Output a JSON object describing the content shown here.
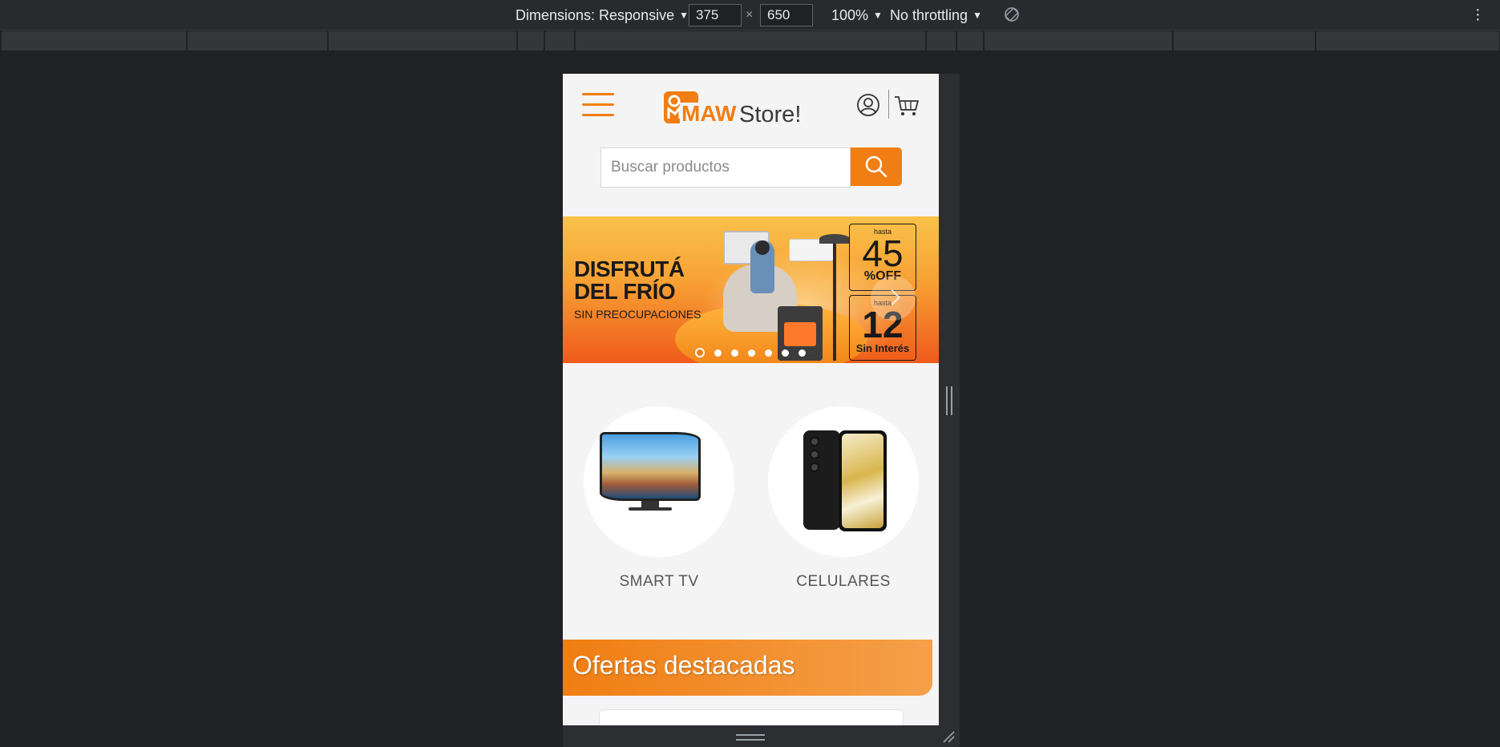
{
  "devtools": {
    "dimensions_label": "Dimensions: Responsive",
    "width_value": "375",
    "times": "×",
    "height_value": "650",
    "zoom": "100%",
    "throttling": "No throttling"
  },
  "site": {
    "logo_primary": "MAW",
    "logo_secondary": "Store!",
    "search_placeholder": "Buscar productos",
    "banner": {
      "headline_1": "DISFRUTÁ",
      "headline_2": "DEL FRÍO",
      "subline": "SIN PREOCUPACIONES",
      "promo1_small": "hasta",
      "promo1_big": "45",
      "promo1_tag": "%OFF",
      "promo2_small": "hasta",
      "promo2_big": "12",
      "promo2_tag": "Sin Interés",
      "slides": 7,
      "active_slide": 1
    },
    "categories": [
      {
        "label": "SMART TV",
        "icon": "smart-tv-image"
      },
      {
        "label": "CELULARES",
        "icon": "smartphone-image"
      }
    ],
    "section_title": "Ofertas destacadas",
    "colors": {
      "brand_orange": "#f07e12",
      "page_bg": "#f4f4f4"
    }
  }
}
